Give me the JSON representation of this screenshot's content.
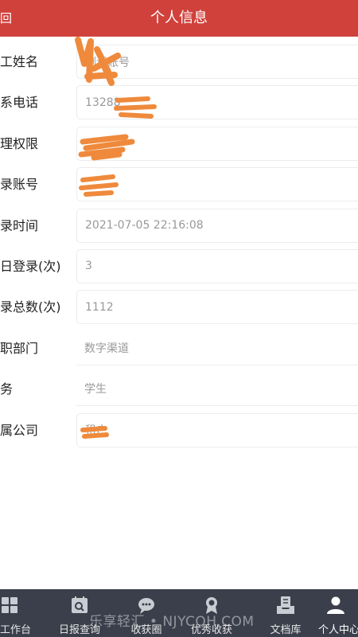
{
  "header": {
    "back_label": "回",
    "title": "个人信息"
  },
  "form": {
    "rows": [
      {
        "label": "工姓名",
        "value": "测试账号",
        "border": true
      },
      {
        "label": "系电话",
        "value": "13288",
        "border": true
      },
      {
        "label": "理权限",
        "value": "",
        "border": true
      },
      {
        "label": "录账号",
        "value": "",
        "border": true
      },
      {
        "label": "录时间",
        "value": "2021-07-05 22:16:08",
        "border": true
      },
      {
        "label": "日登录(次)",
        "value": "3",
        "border": true
      },
      {
        "label": "录总数(次)",
        "value": "1112",
        "border": true
      },
      {
        "label": "职部门",
        "value": "数字渠道",
        "border": false
      },
      {
        "label": "务",
        "value": "学生",
        "border": false
      },
      {
        "label": "属公司",
        "value": "租户",
        "border": true
      }
    ]
  },
  "tabbar": {
    "items": [
      {
        "label": "工作台",
        "icon": "grid-icon",
        "active": false
      },
      {
        "label": "日报查询",
        "icon": "search-calendar-icon",
        "active": false
      },
      {
        "label": "收获圈",
        "icon": "chat-bubble-icon",
        "active": false
      },
      {
        "label": "优秀收获",
        "icon": "award-icon",
        "active": false
      },
      {
        "label": "文档库",
        "icon": "document-tray-icon",
        "active": false
      },
      {
        "label": "个人中心",
        "icon": "person-icon",
        "active": true
      }
    ]
  },
  "watermark": "乐享轻汇 • NJYCOH.COM",
  "colors": {
    "header_bg": "#d0413b",
    "tabbar_bg": "#3a3f4b",
    "redaction": "#ef8a3c"
  }
}
